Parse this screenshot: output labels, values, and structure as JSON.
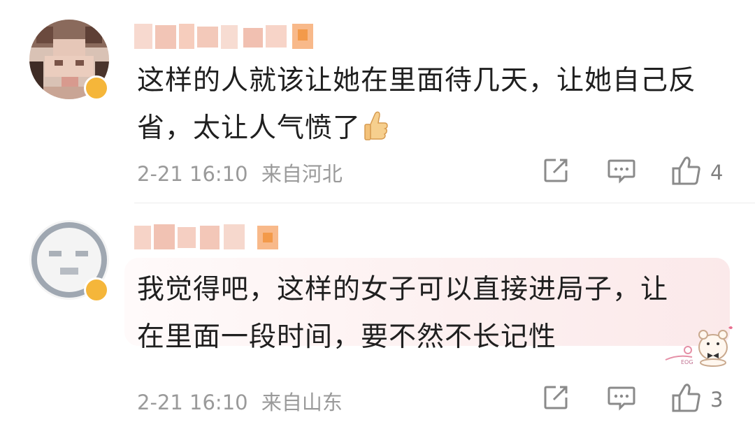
{
  "comments": [
    {
      "username": "",
      "text_line1": "这样的人就该让她在里面待几天，让她自己反",
      "text_line2": "省，太让人气愤了",
      "emoji": "thumbs-up",
      "date": "2-21 16:10",
      "location": "来自河北",
      "likes": "4"
    },
    {
      "username": "",
      "text_line1": "我觉得吧，这样的女子可以直接进局子，让",
      "text_line2": "在里面一段时间，要不然不长记性",
      "date": "2-21 16:10",
      "location": "来自山东",
      "likes": "3",
      "bubble_sticker": "EOG"
    }
  ],
  "colors": {
    "meta_text": "#9a9a9a",
    "icon_stroke": "#8a8a8a",
    "verified_badge": "#f5b63a",
    "bubble_pink": "#fbe9ea"
  },
  "icons": [
    "share-icon",
    "reply-icon",
    "like-icon",
    "thumbs-up-emoji",
    "verified-badge-icon"
  ]
}
